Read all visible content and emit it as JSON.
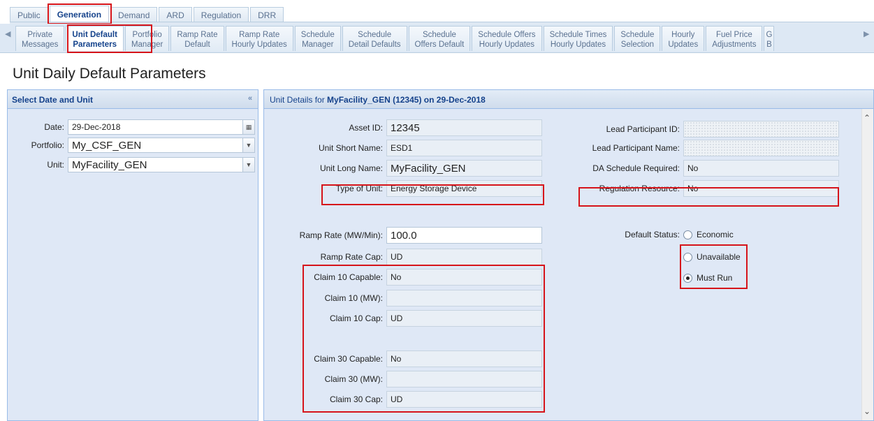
{
  "top_tabs": [
    "Public",
    "Generation",
    "Demand",
    "ARD",
    "Regulation",
    "DRR"
  ],
  "sub_tabs": [
    "Private\nMessages",
    "Unit Default\nParameters",
    "Portfolio\nManager",
    "Ramp Rate\nDefault",
    "Ramp Rate\nHourly Updates",
    "Schedule\nManager",
    "Schedule\nDetail Defaults",
    "Schedule\nOffers Default",
    "Schedule Offers\nHourly Updates",
    "Schedule Times\nHourly Updates",
    "Schedule\nSelection",
    "Hourly\nUpdates",
    "Fuel Price\nAdjustments",
    "G\nB"
  ],
  "page_title": "Unit Daily Default Parameters",
  "left": {
    "header": "Select Date and Unit",
    "date_label": "Date:",
    "date_value": "29-Dec-2018",
    "portfolio_label": "Portfolio:",
    "portfolio_value": "My_CSF_GEN",
    "unit_label": "Unit:",
    "unit_value": "MyFacility_GEN"
  },
  "right": {
    "header_prefix": "Unit Details for",
    "header_detail": "MyFacility_GEN (12345) on 29-Dec-2018",
    "asset_id_label": "Asset ID:",
    "asset_id": "12345",
    "short_name_label": "Unit Short Name:",
    "short_name": "ESD1",
    "long_name_label": "Unit Long Name:",
    "long_name": "MyFacility_GEN",
    "type_label": "Type of Unit:",
    "type_value": "Energy Storage Device",
    "lead_id_label": "Lead Participant ID:",
    "lead_name_label": "Lead Participant Name:",
    "da_label": "DA Schedule Required:",
    "da_value": "No",
    "reg_label": "Regulation Resource:",
    "reg_value": "No",
    "ramp_label": "Ramp Rate (MW/Min):",
    "ramp_value": "100.0",
    "ramp_cap_label": "Ramp Rate Cap:",
    "ramp_cap_value": "UD",
    "c10_capable_label": "Claim 10 Capable:",
    "c10_capable_value": "No",
    "c10_mw_label": "Claim 10 (MW):",
    "c10_mw_value": "",
    "c10_cap_label": "Claim 10 Cap:",
    "c10_cap_value": "UD",
    "c30_capable_label": "Claim 30 Capable:",
    "c30_capable_value": "No",
    "c30_mw_label": "Claim 30 (MW):",
    "c30_mw_value": "",
    "c30_cap_label": "Claim 30 Cap:",
    "c30_cap_value": "UD",
    "default_status_label": "Default Status:",
    "status_options": [
      "Economic",
      "Unavailable",
      "Must Run"
    ],
    "status_selected": "Must Run"
  },
  "icons": {
    "collapse": "double-chevron-left-icon",
    "calendar": "calendar-icon",
    "dropdown": "chevron-down-icon",
    "scroll_left": "arrow-left-icon",
    "scroll_right": "arrow-right-icon"
  },
  "colors": {
    "highlight": "#d6141a",
    "header_text": "#15428b",
    "panel_bg": "#dfe8f6"
  }
}
